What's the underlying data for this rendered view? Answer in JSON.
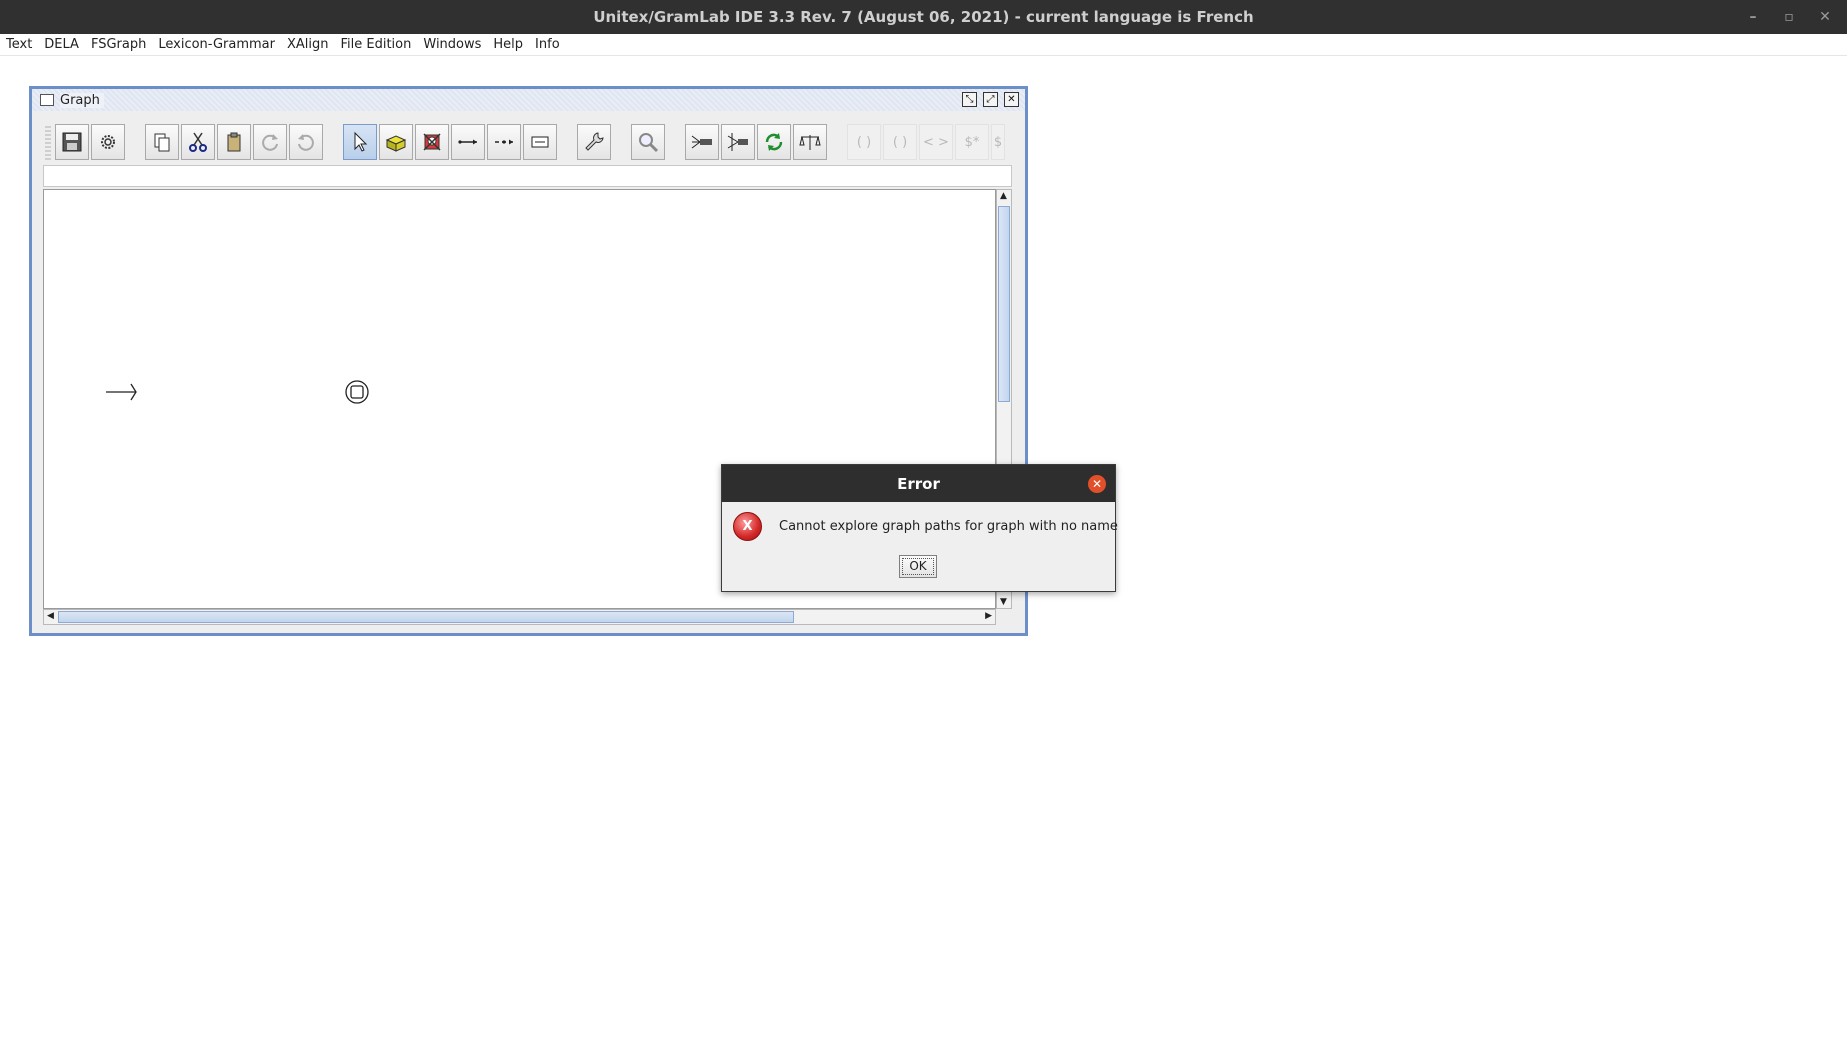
{
  "window": {
    "title": "Unitex/GramLab IDE 3.3  Rev. 7 (August 06, 2021) - current language is French",
    "controls": {
      "minimize": "–",
      "restore": "▫",
      "close": "✕"
    }
  },
  "menu": [
    "Text",
    "DELA",
    "FSGraph",
    "Lexicon-Grammar",
    "XAlign",
    "File Edition",
    "Windows",
    "Help",
    "Info"
  ],
  "graph_frame": {
    "title": "Graph",
    "buttons": {
      "iconify": "⤡",
      "maximize": "⤢",
      "close": "✕"
    },
    "toolbar": {
      "disabled_labels": [
        "( )",
        "( )",
        "< >",
        "$*",
        "$"
      ]
    },
    "box_text": ""
  },
  "error_dialog": {
    "title": "Error",
    "close_glyph": "✕",
    "icon_glyph": "X",
    "message": "Cannot explore graph paths for graph with no name",
    "ok_label": "OK"
  },
  "colors": {
    "titlebar": "#303030",
    "frame_border": "#6c8ec9",
    "error_red": "#d22727",
    "dialog_close": "#e1502a"
  }
}
